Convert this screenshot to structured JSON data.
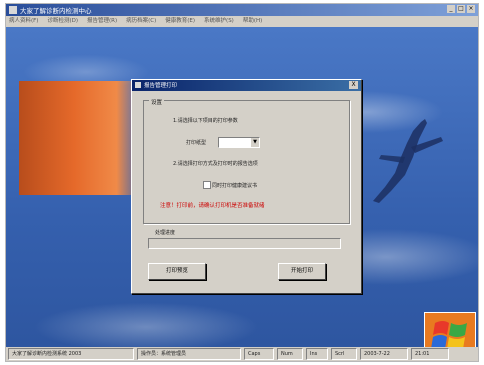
{
  "window": {
    "title": "大家了解诊断内检测中心",
    "buttons": [
      "_",
      "□",
      "×"
    ]
  },
  "menu": [
    "病人资料(F)",
    "诊断检测(D)",
    "报告管理(R)",
    "病历档案(C)",
    "健康教育(E)",
    "系统维护(S)",
    "帮助(H)"
  ],
  "dialog": {
    "title": "报告管理打印",
    "close": "X",
    "group_label": "设置",
    "step1": "1.请选择以下项目的打印参数",
    "page_label": "打印纸型",
    "page_value": "",
    "step2": "2.请选择打印方式及打印时的报告选项",
    "checkbox_label": "同时打印健康建议书",
    "warning": "注意！打印前，请确认打印机是否准备就绪",
    "progress_label": "处理进度",
    "preview_button": "打印预览",
    "print_button": "开始打印"
  },
  "statusbar": [
    "大家了解诊断内检测系统 2003",
    "操作员：系统管理员",
    "Caps",
    "Num",
    "Ins",
    "Scrl",
    "2003-7-22",
    "21:01"
  ]
}
